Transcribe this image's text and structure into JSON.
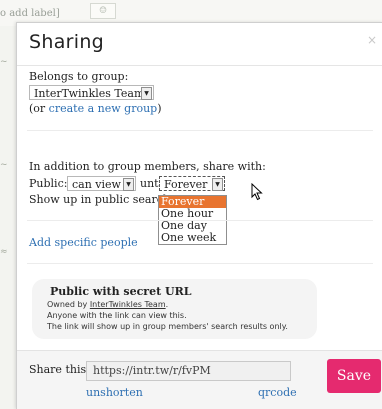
{
  "background": {
    "top_label": "o add label]",
    "top_box": "☺",
    "left_marks": [
      "~",
      "~",
      "ℹ",
      "≈"
    ]
  },
  "dialog": {
    "title": "Sharing",
    "close_label": "×",
    "belongs_label": "Belongs to group:",
    "group_value": "InterTwinkles Team",
    "or_prefix": "(or ",
    "create_group_link": "create a new group",
    "or_suffix": ")",
    "share_with_label": "In addition to group members, share with:",
    "public_label": "Public:",
    "public_value": "can view",
    "until_label": "until",
    "until_value": "Forever",
    "until_options": [
      "Forever",
      "One hour",
      "One day",
      "One week"
    ],
    "until_selected_index": 0,
    "searches_label": "Show up in public searches",
    "add_people_link": "Add specific people",
    "secret": {
      "title": "Public with secret URL",
      "owned_prefix": "Owned by ",
      "owner": "InterTwinkles Team",
      "owned_suffix": ".",
      "line2": "Anyone with the link can view this.",
      "line3": "The link will show up in group members' search results only."
    },
    "footer": {
      "share_label": "Share this:",
      "url": "https://intr.tw/r/fvPM",
      "unshorten_link": "unshorten",
      "qrcode_link": "qrcode",
      "save_label": "Save"
    }
  },
  "colors": {
    "accent": "#e52a6f",
    "link": "#2d6fb2",
    "dropdown_highlight": "#e8742f"
  }
}
